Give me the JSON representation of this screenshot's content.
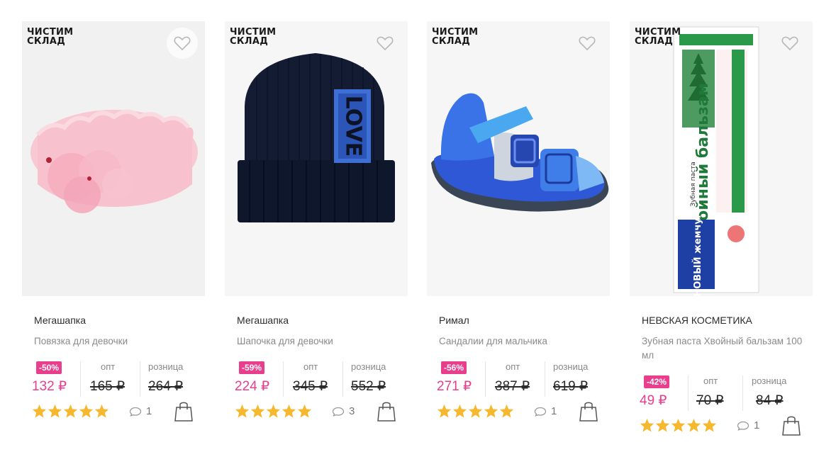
{
  "products": [
    {
      "sale_badge_line1": "ЧИСТИМ",
      "sale_badge_line2": "СКЛАД",
      "brand": "Мегашапка",
      "title": "Повязка для девочки",
      "discount": "-50%",
      "price": "132 ₽",
      "opt_label": "опт",
      "opt_price": "165 ₽",
      "retail_label": "розница",
      "retail_price": "264 ₽",
      "rating": 5,
      "comments": "1",
      "icons": [
        "heart-icon",
        "star-icon",
        "comment-icon",
        "shopping-bag-icon"
      ]
    },
    {
      "sale_badge_line1": "ЧИСТИМ",
      "sale_badge_line2": "СКЛАД",
      "brand": "Мегашапка",
      "title": "Шапочка для девочки",
      "discount": "-59%",
      "price": "224 ₽",
      "opt_label": "опт",
      "opt_price": "345 ₽",
      "retail_label": "розница",
      "retail_price": "552 ₽",
      "rating": 5,
      "comments": "3",
      "hat_text": "LOVE"
    },
    {
      "sale_badge_line1": "ЧИСТИМ",
      "sale_badge_line2": "СКЛАД",
      "brand": "Римал",
      "title": "Сандалии для мальчика",
      "discount": "-56%",
      "price": "271 ₽",
      "opt_label": "опт",
      "opt_price": "387 ₽",
      "retail_label": "розница",
      "retail_price": "619 ₽",
      "rating": 5,
      "comments": "1"
    },
    {
      "sale_badge_line1": "ЧИСТИМ",
      "sale_badge_line2": "СКЛАД",
      "brand": "НЕВСКАЯ КОСМЕТИКА",
      "title": "Зубная паста Хвойный бальзам 100 мл",
      "discount": "-42%",
      "price": "49 ₽",
      "opt_label": "опт",
      "opt_price": "70 ₽",
      "retail_label": "розница",
      "retail_price": "84 ₽",
      "rating": 5,
      "comments": "1",
      "package_brand": "НОВЫЙ жемчуг",
      "package_product": "Хвойный бальзам",
      "package_subtitle": "Зубная паста"
    }
  ],
  "colors": {
    "accent": "#e83e8c",
    "star": "#f5b82e",
    "text": "#2b2b2b",
    "muted": "#8a8a8a"
  }
}
